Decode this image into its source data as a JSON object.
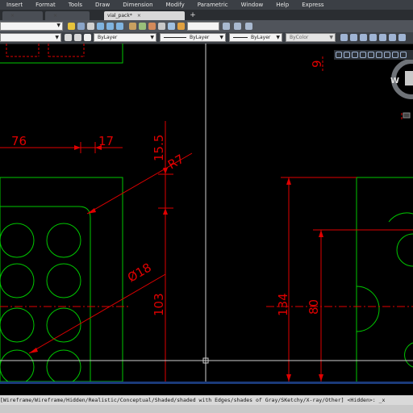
{
  "menubar": {
    "items": [
      "Insert",
      "Format",
      "Tools",
      "Draw",
      "Dimension",
      "Modify",
      "Parametric",
      "Window",
      "Help",
      "Express"
    ]
  },
  "tabs": [
    {
      "label": "",
      "active": false
    },
    {
      "label": "",
      "active": false
    },
    {
      "label": "vial_pack*",
      "active": true
    }
  ],
  "properties": {
    "color": "ByLayer",
    "linetype": "ByLayer",
    "lineweight": "ByLayer",
    "plotstyle": "ByColor"
  },
  "viewcube": {
    "compass_label": "W"
  },
  "drawing": {
    "dims": [
      "76",
      "17",
      "15.5",
      "R7",
      "Ø18",
      "103",
      "134",
      "80",
      "9"
    ]
  },
  "command_line": "[Wireframe/Wireframe/Hidden/Realistic/Conceptual/Shaded/shaded with Edges/shades of Gray/SKetchy/X-ray/Other] <Hidden>: _x",
  "colors": {
    "geometry": "#00c800",
    "dimensions": "#e00000",
    "crosshair": "#d0d0d0",
    "background": "#000000"
  }
}
